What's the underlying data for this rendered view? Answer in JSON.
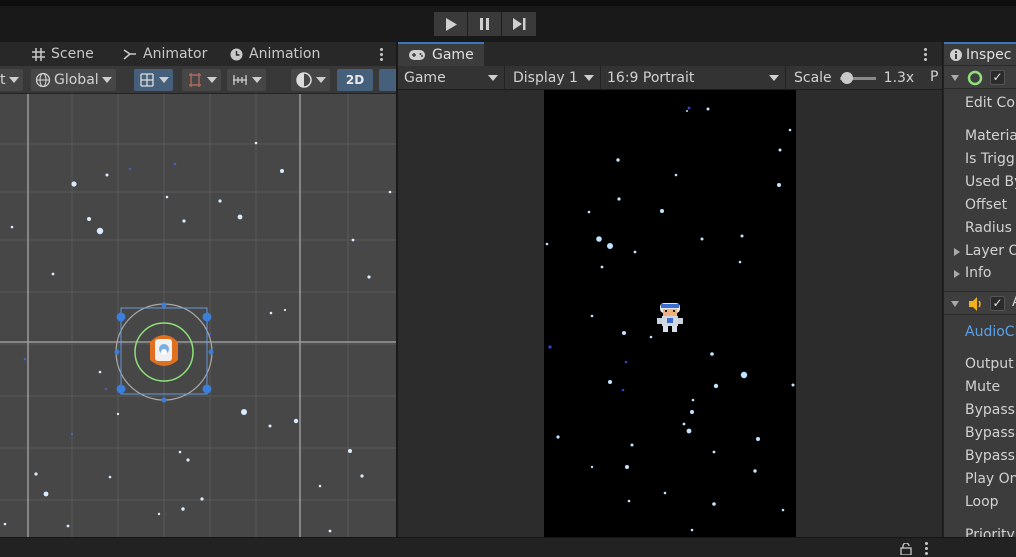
{
  "toolbar": {
    "play_icon": "play-icon",
    "pause_icon": "pause-icon",
    "step_icon": "step-icon"
  },
  "scene_panel": {
    "tabs": [
      {
        "label": "Scene",
        "icon": "grid-icon"
      },
      {
        "label": "Animator",
        "icon": "animator-icon"
      },
      {
        "label": "Animation",
        "icon": "clock-icon"
      }
    ],
    "controls": {
      "pivot_label": "t",
      "space_label": "Global",
      "mode_2d_label": "2D"
    }
  },
  "game_panel": {
    "tab_label": "Game",
    "tab_icon": "gamepad-icon",
    "view_dropdown": "Game",
    "display_dropdown": "Display 1",
    "aspect_dropdown": "16:9 Portrait",
    "scale_label": "Scale",
    "scale_value": "1.3x",
    "scale_fraction": 0.05,
    "truncated_label": "P"
  },
  "inspector": {
    "tab_label": "Inspec",
    "collider_rows": [
      "Edit Col",
      "Materia",
      "Is Trigg",
      "Used By",
      "Offset",
      "Radius"
    ],
    "foldouts": [
      "Layer O",
      "Info"
    ],
    "audio_header": "A",
    "audio_clip_label": "AudioCl",
    "audio_rows": [
      "Output",
      "Mute",
      "Bypass",
      "Bypass",
      "Bypass",
      "Play On",
      "Loop",
      "Priority"
    ]
  },
  "colors": {
    "accent": "#3a79bb",
    "active_button": "#46607c",
    "panel": "#383838",
    "game_canvas": "#000000"
  }
}
